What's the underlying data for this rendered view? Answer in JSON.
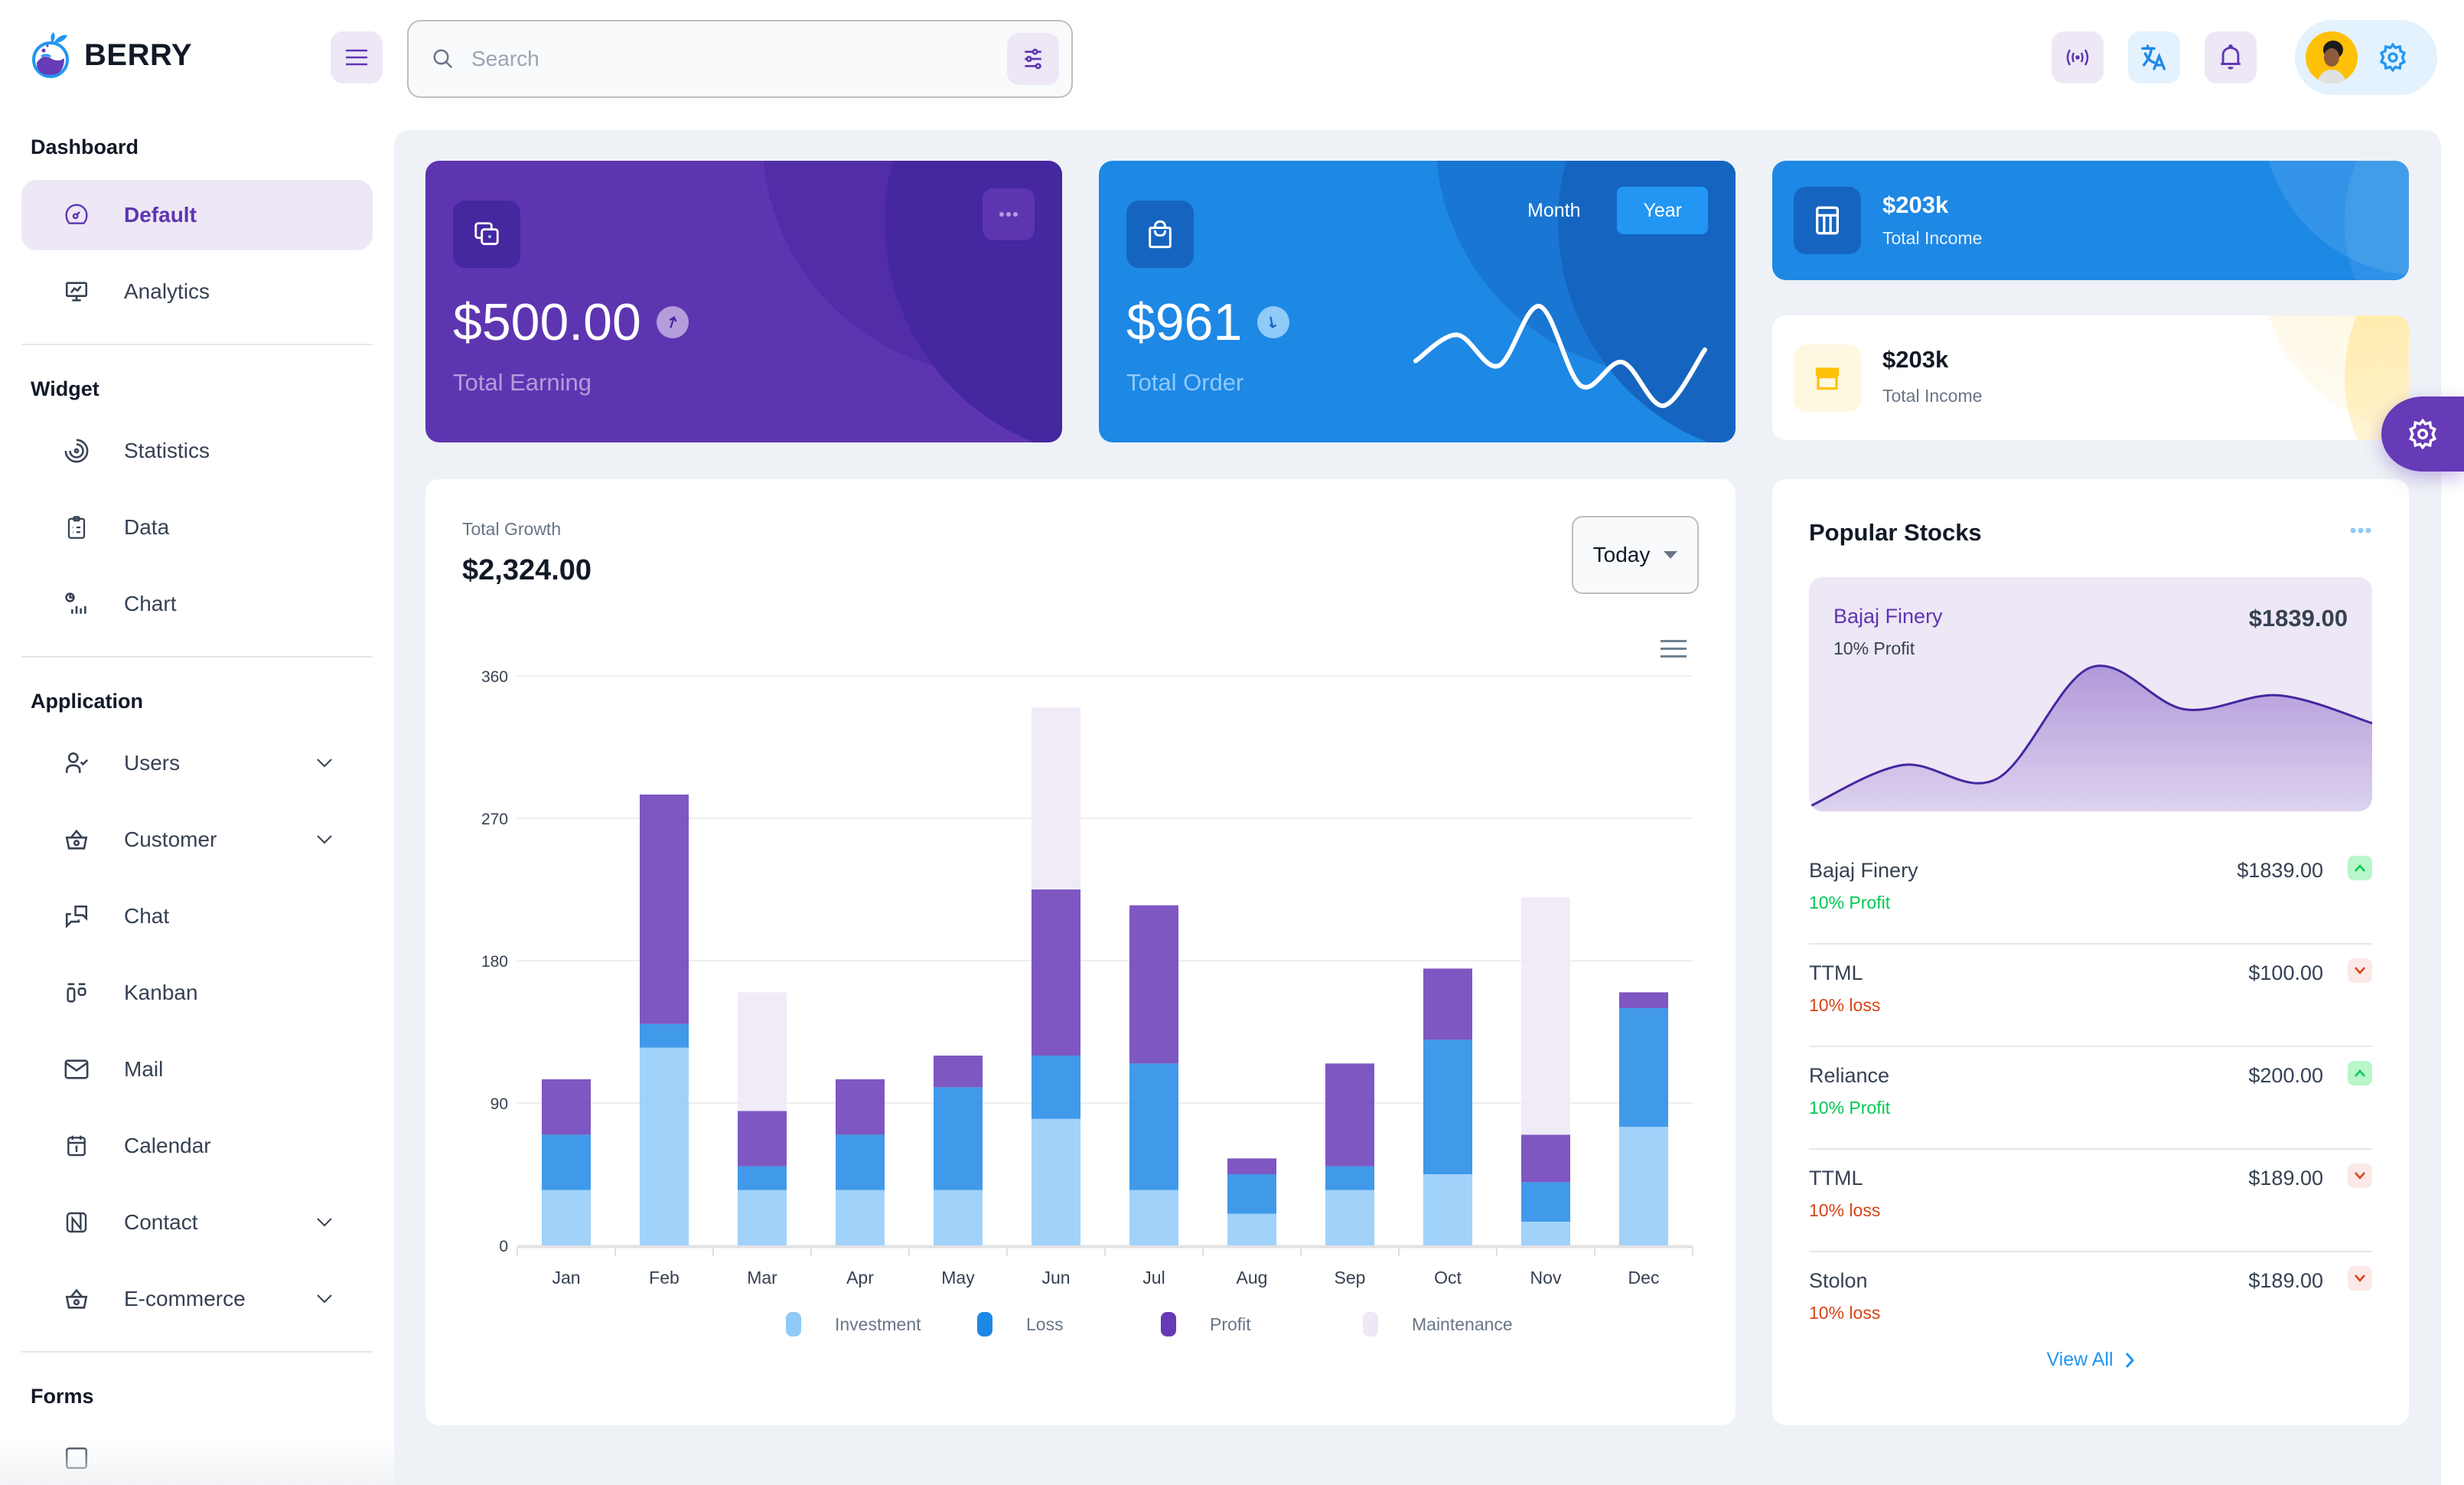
{
  "app": {
    "brand": "BERRY"
  },
  "header": {
    "search_placeholder": "Search",
    "search_value": "",
    "icons": [
      "live-icon",
      "translate-icon",
      "bell-icon",
      "settings-icon"
    ]
  },
  "sidebar": {
    "sections": [
      {
        "title": "Dashboard",
        "items": [
          {
            "label": "Default",
            "icon": "dashboard-icon",
            "active": true,
            "expandable": false
          },
          {
            "label": "Analytics",
            "icon": "analytics-icon",
            "active": false,
            "expandable": false
          }
        ]
      },
      {
        "title": "Widget",
        "items": [
          {
            "label": "Statistics",
            "icon": "statistics-icon",
            "expandable": false
          },
          {
            "label": "Data",
            "icon": "clipboard-icon",
            "expandable": false
          },
          {
            "label": "Chart",
            "icon": "chart-icon",
            "expandable": false
          }
        ]
      },
      {
        "title": "Application",
        "items": [
          {
            "label": "Users",
            "icon": "user-check-icon",
            "expandable": true
          },
          {
            "label": "Customer",
            "icon": "basket-icon",
            "expandable": true
          },
          {
            "label": "Chat",
            "icon": "messages-icon",
            "expandable": false
          },
          {
            "label": "Kanban",
            "icon": "kanban-icon",
            "expandable": false
          },
          {
            "label": "Mail",
            "icon": "mail-icon",
            "expandable": false
          },
          {
            "label": "Calendar",
            "icon": "calendar-icon",
            "expandable": false
          },
          {
            "label": "Contact",
            "icon": "nfc-icon",
            "expandable": true
          },
          {
            "label": "E-commerce",
            "icon": "basket-icon",
            "expandable": true
          }
        ]
      },
      {
        "title": "Forms",
        "items": []
      }
    ]
  },
  "cards": {
    "earning": {
      "value": "$500.00",
      "label": "Total Earning",
      "trend": "up"
    },
    "order": {
      "value": "$961",
      "label": "Total Order",
      "trend": "down",
      "toggle": [
        "Month",
        "Year"
      ],
      "active_toggle": "Year",
      "sparkline": [
        45,
        66,
        41,
        89,
        25,
        44,
        9,
        54
      ]
    },
    "income_primary": {
      "value": "$203k",
      "label": "Total Income"
    },
    "income_secondary": {
      "value": "$203k",
      "label": "Total Income"
    }
  },
  "growth": {
    "title": "Total Growth",
    "value": "$2,324.00",
    "period": "Today"
  },
  "chart_data": {
    "type": "bar",
    "stacked": true,
    "title": "Total Growth",
    "categories": [
      "Jan",
      "Feb",
      "Mar",
      "Apr",
      "May",
      "Jun",
      "Jul",
      "Aug",
      "Sep",
      "Oct",
      "Nov",
      "Dec"
    ],
    "series": [
      {
        "name": "Investment",
        "color": "#90caf9",
        "values": [
          35,
          125,
          35,
          35,
          35,
          80,
          35,
          20,
          35,
          45,
          15,
          75
        ]
      },
      {
        "name": "Loss",
        "color": "#1e88e5",
        "values": [
          35,
          15,
          15,
          35,
          65,
          40,
          80,
          25,
          15,
          85,
          25,
          75
        ]
      },
      {
        "name": "Profit",
        "color": "#673ab7",
        "values": [
          35,
          145,
          35,
          35,
          20,
          105,
          100,
          10,
          65,
          45,
          30,
          10
        ]
      },
      {
        "name": "Maintenance",
        "color": "#ede7f6",
        "values": [
          0,
          0,
          75,
          0,
          0,
          115,
          0,
          0,
          0,
          0,
          150,
          0
        ]
      }
    ],
    "yticks": [
      0,
      90,
      180,
      270,
      360
    ],
    "ylim": [
      0,
      360
    ],
    "grid": true,
    "legend": "bottom",
    "xlabel": "",
    "ylabel": ""
  },
  "stocks": {
    "title": "Popular Stocks",
    "featured": {
      "name": "Bajaj Finery",
      "status": "10% Profit",
      "value": "$1839.00",
      "series": [
        0,
        15,
        10,
        50,
        35,
        40,
        30
      ]
    },
    "items": [
      {
        "name": "Bajaj Finery",
        "value": "$1839.00",
        "status": "10% Profit",
        "direction": "up"
      },
      {
        "name": "TTML",
        "value": "$100.00",
        "status": "10% loss",
        "direction": "down"
      },
      {
        "name": "Reliance",
        "value": "$200.00",
        "status": "10% Profit",
        "direction": "up"
      },
      {
        "name": "TTML",
        "value": "$189.00",
        "status": "10% loss",
        "direction": "down"
      },
      {
        "name": "Stolon",
        "value": "$189.00",
        "status": "10% loss",
        "direction": "down"
      }
    ],
    "view_all": "View All"
  },
  "colors": {
    "primary": "#5e35b1",
    "secondary": "#1e88e5",
    "success": "#00c853",
    "error": "#d84315",
    "warning": "#ffc107"
  }
}
